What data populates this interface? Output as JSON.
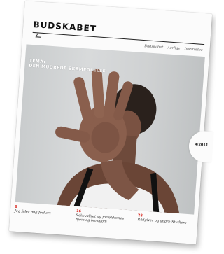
{
  "magazine": {
    "title": "BUDSKABET",
    "nav": [
      "Budskabet",
      "Aarlige",
      "Instituttes"
    ],
    "theme_line1": "TEMA:",
    "theme_line2": "DEN MUDREDE SKAMFØLELSE",
    "issue": "4/2011",
    "teasers": [
      {
        "number": "8",
        "text": "Jeg føler mig forkert"
      },
      {
        "number": "16",
        "text": "Seksualitet og forældrenes hjem og barndom"
      },
      {
        "number": "28",
        "text": "Rådgiver og andre Studiers"
      }
    ]
  },
  "colors": {
    "accent": "#d8241c",
    "page": "#fbfbfb",
    "photo_background": "#cfd1d2"
  }
}
